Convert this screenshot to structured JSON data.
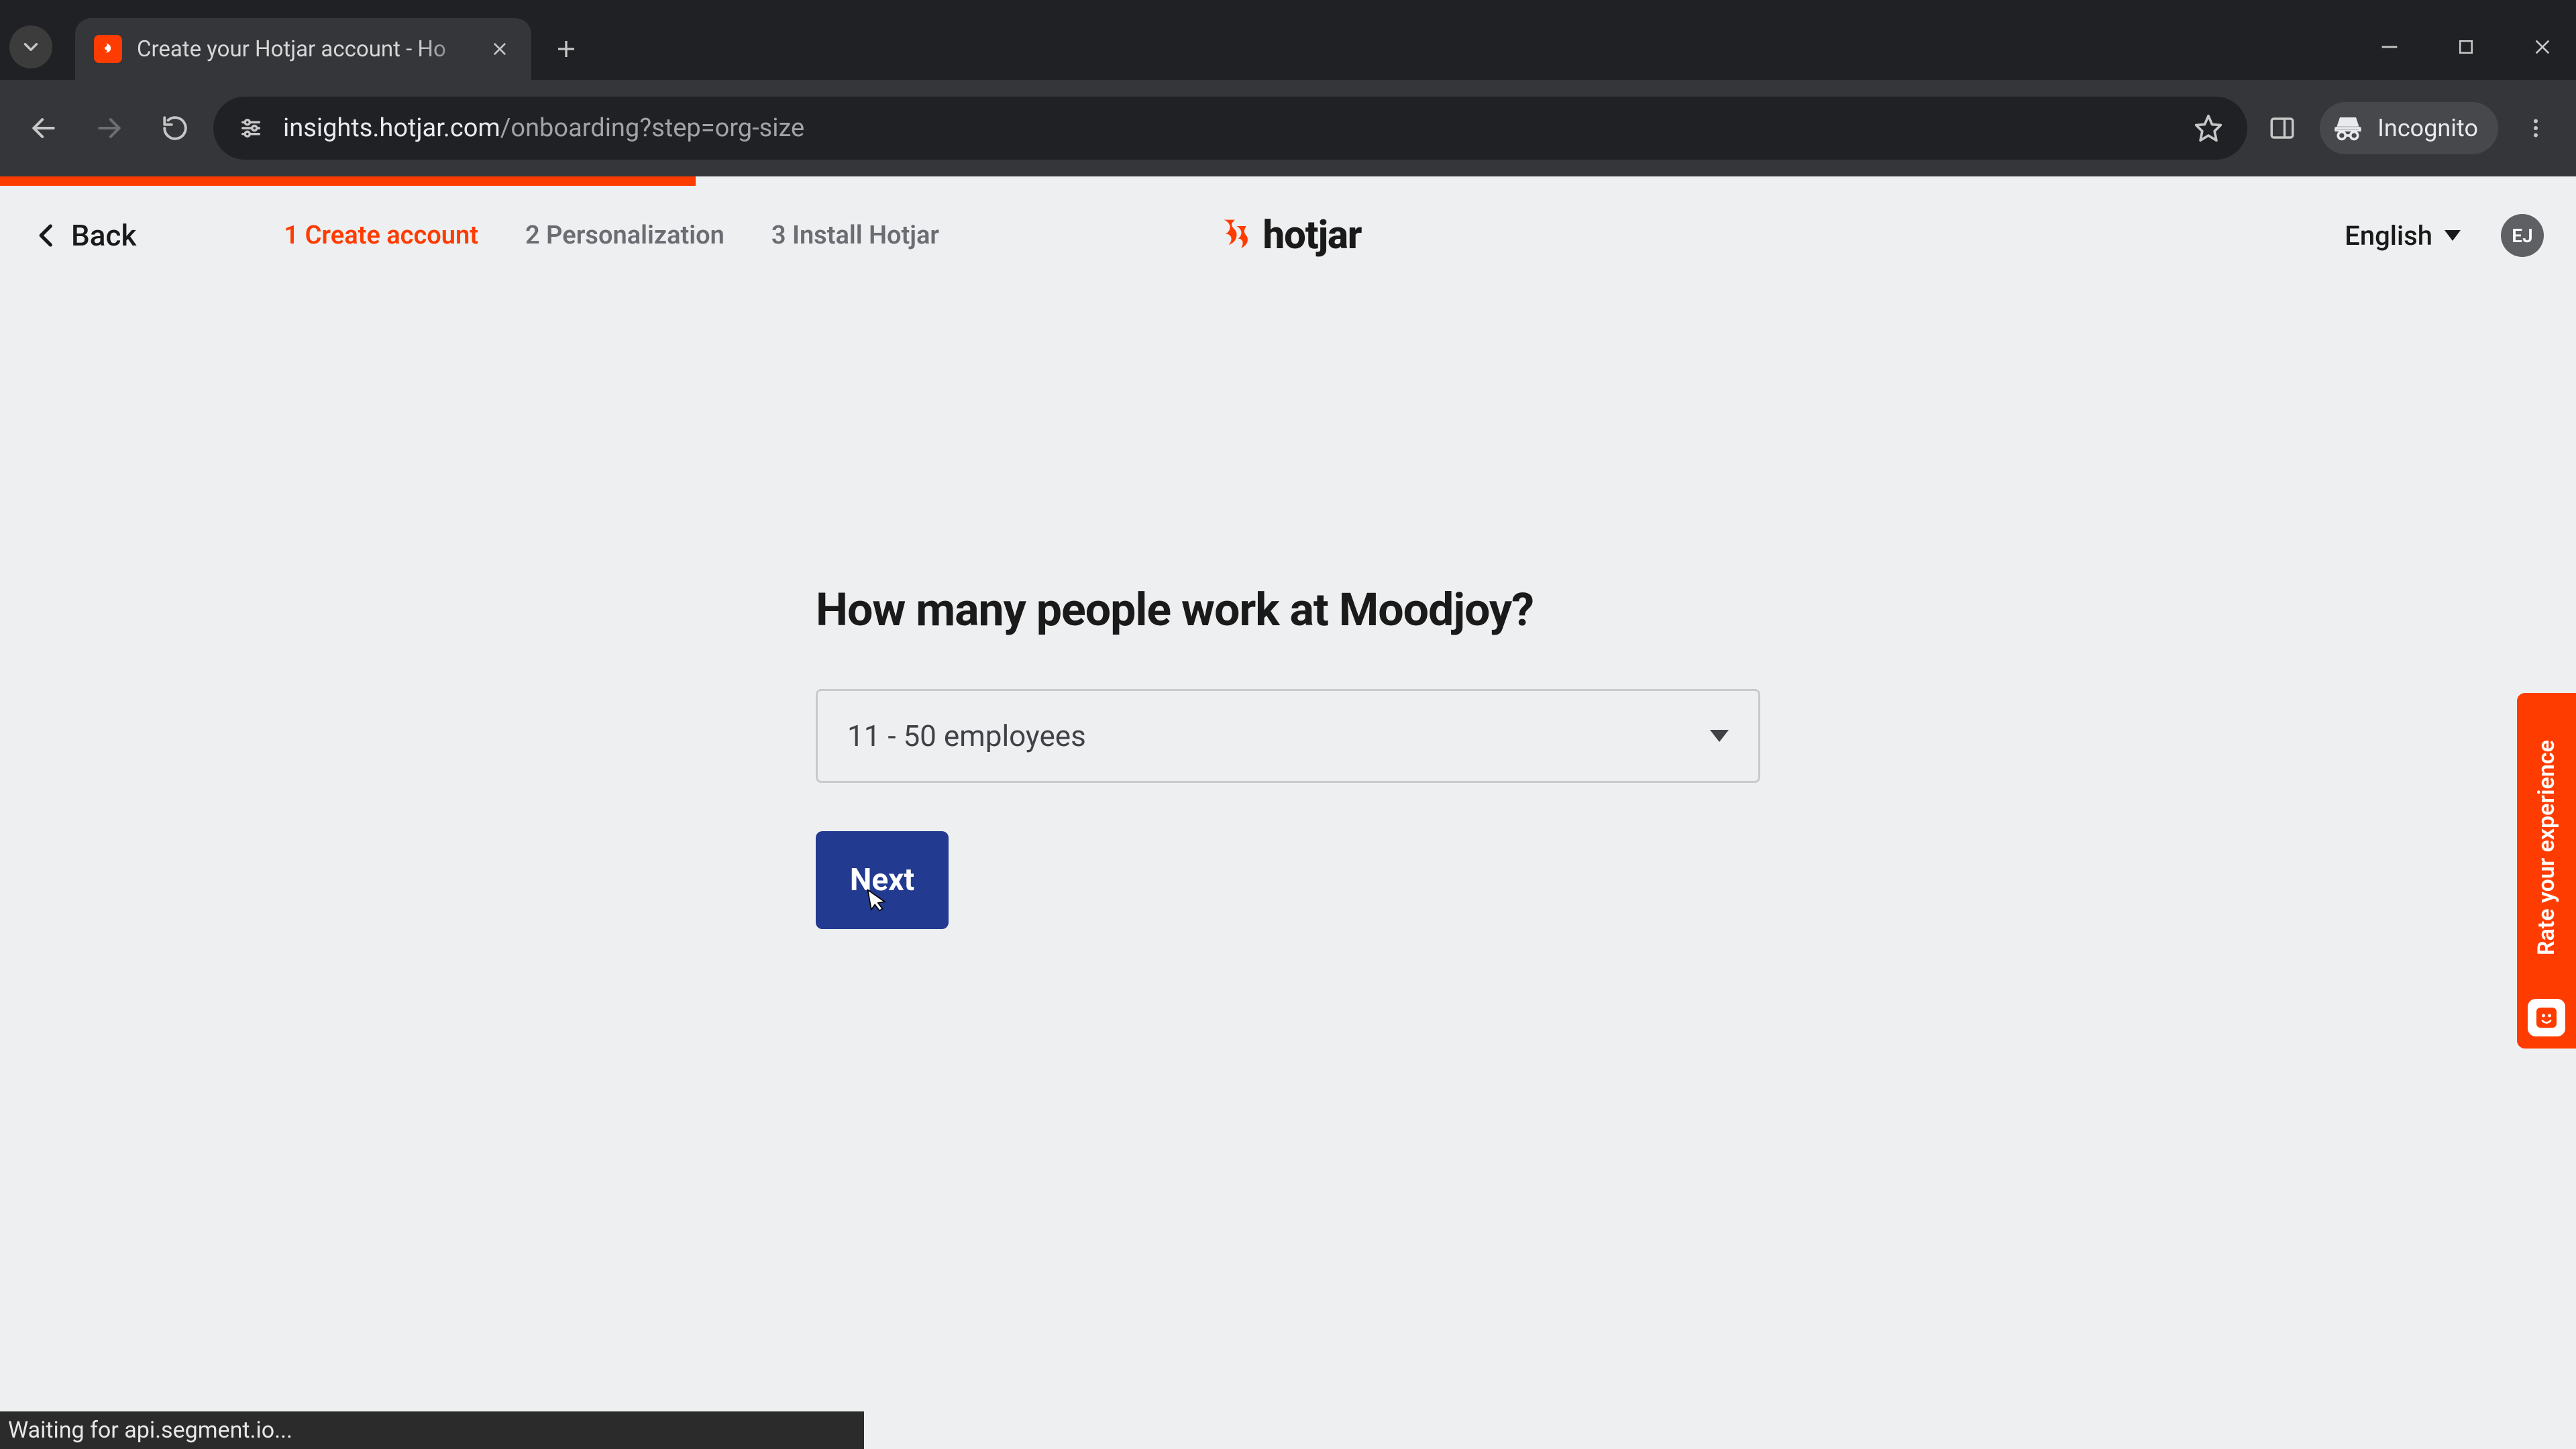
{
  "browser": {
    "tab_title": "Create your Hotjar account - Ho",
    "url_host": "insights.hotjar.com",
    "url_path": "/onboarding?step=org-size",
    "incognito_label": "Incognito",
    "status_text": "Waiting for api.segment.io..."
  },
  "header": {
    "back_label": "Back",
    "steps": [
      {
        "label": "1 Create account",
        "active": true
      },
      {
        "label": "2 Personalization",
        "active": false
      },
      {
        "label": "3 Install Hotjar",
        "active": false
      }
    ],
    "brand": "hotjar",
    "language_label": "English",
    "avatar_initials": "EJ"
  },
  "form": {
    "heading": "How many people work at Moodjoy?",
    "org_size_value": "11 - 50 employees",
    "next_label": "Next"
  },
  "feedback": {
    "label": "Rate your experience"
  },
  "colors": {
    "accent": "#ff3c00",
    "primary_button": "#223a8f",
    "page_bg": "#eeeff0"
  }
}
